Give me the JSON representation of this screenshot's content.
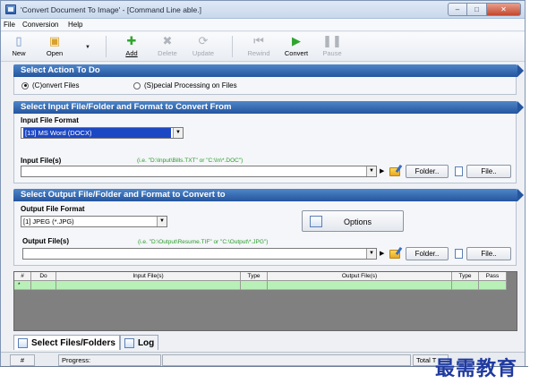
{
  "window": {
    "title": "'Convert Document To Image' - [Command Line able.]",
    "min": "–",
    "max": "□",
    "close": "✕"
  },
  "menu": [
    "File",
    "Conversion",
    "Help"
  ],
  "toolbar": {
    "new": "New",
    "open": "Open",
    "add": "Add",
    "delete": "Delete",
    "update": "Update",
    "rewind": "Rewind",
    "convert": "Convert",
    "pause": "Pause"
  },
  "action": {
    "header": "Select Action To Do",
    "convert_files": "(C)onvert Files",
    "special": "(S)pecial Processing on Files",
    "selected": "convert"
  },
  "input": {
    "header": "Select Input File/Folder and Format to Convert From",
    "format_label": "Input File Format",
    "format_value": "[13] MS Word (DOCX)",
    "files_label": "Input File(s)",
    "files_hint": "(i.e. \"D:\\Input\\Bills.TXT\"  or  \"C:\\In\\*.DOC\")",
    "files_value": "",
    "folder_btn": "Folder..",
    "file_btn": "File.."
  },
  "output": {
    "header": "Select Output File/Folder and Format to Convert to",
    "format_label": "Output File Format",
    "format_value": "[1] JPEG (*.JPG)",
    "options_btn": "Options",
    "files_label": "Output File(s)",
    "files_hint": "(i.e. \"D:\\Output\\Resume.TIF\"  or  \"C:\\Output\\*.JPG\")",
    "files_value": "",
    "folder_btn": "Folder..",
    "file_btn": "File.."
  },
  "grid": {
    "columns": [
      "#",
      "Do",
      "Input File(s)",
      "Type",
      "Output File(s)",
      "Type",
      "Pass"
    ],
    "row_marker": "*"
  },
  "tabs": {
    "files": "Select Files/Folders",
    "log": "Log"
  },
  "status": {
    "hash": "#",
    "progress": "Progress:",
    "total": "Total T"
  },
  "watermark": "最需教育"
}
